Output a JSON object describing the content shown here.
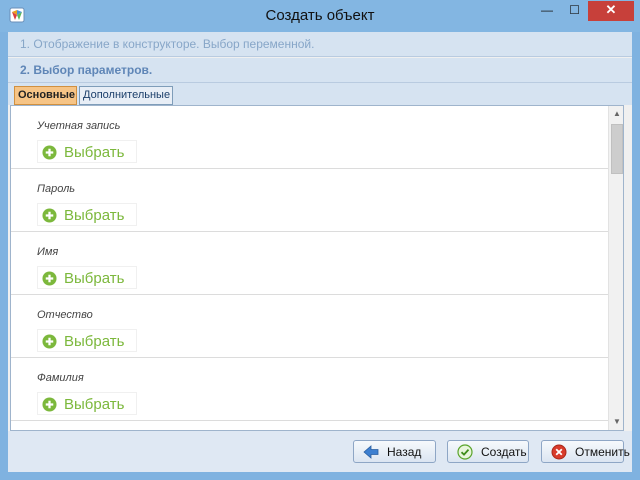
{
  "window": {
    "title": "Создать объект",
    "icon": "app-logo-icon",
    "controls": {
      "minimize": "—",
      "maximize": "☐",
      "close": "✕"
    }
  },
  "steps": [
    {
      "label": "1. Отображение в конструкторе. Выбор переменной."
    },
    {
      "label": "2. Выбор параметров."
    }
  ],
  "tabs": [
    {
      "label": "Основные",
      "active": true
    },
    {
      "label": "Дополнительные",
      "active": false
    }
  ],
  "fields": [
    {
      "label": "Учетная запись",
      "action": "Выбрать",
      "icon": "plus-circle-icon"
    },
    {
      "label": "Пароль",
      "action": "Выбрать",
      "icon": "plus-circle-icon"
    },
    {
      "label": "Имя",
      "action": "Выбрать",
      "icon": "plus-circle-icon"
    },
    {
      "label": "Отчество",
      "action": "Выбрать",
      "icon": "plus-circle-icon"
    },
    {
      "label": "Фамилия",
      "action": "Выбрать",
      "icon": "plus-circle-icon"
    }
  ],
  "buttons": {
    "back": {
      "label": "Назад",
      "icon": "arrow-left-icon"
    },
    "create": {
      "label": "Создать",
      "icon": "check-circle-icon"
    },
    "cancel": {
      "label": "Отменить",
      "icon": "cancel-circle-icon"
    }
  },
  "colors": {
    "titlebar": "#83b6e2",
    "accent_green": "#7cb83c",
    "active_tab": "#f6c486",
    "close_button": "#c7403a"
  }
}
